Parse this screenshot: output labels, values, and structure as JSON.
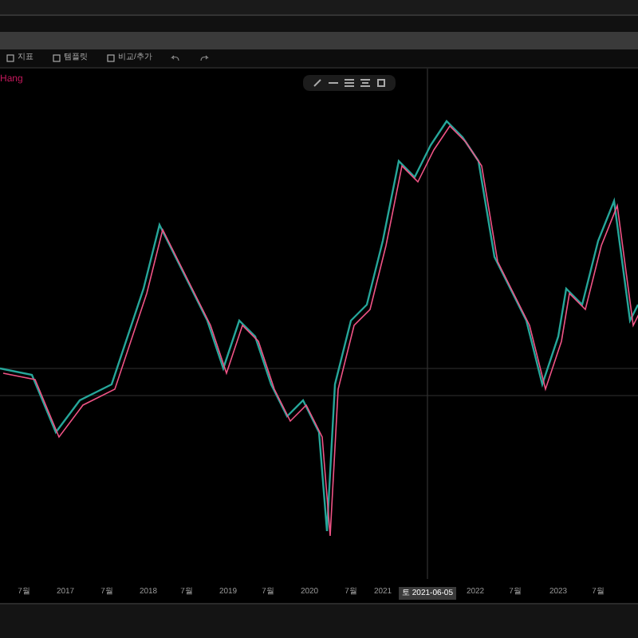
{
  "toolbar": {
    "buttons": [
      {
        "kind": "icon",
        "label": "지표"
      },
      {
        "kind": "icon",
        "label": "템플릿"
      },
      {
        "kind": "icon",
        "label": "비교/추가"
      }
    ]
  },
  "legend": {
    "text": "Hang"
  },
  "x_axis": {
    "labels": [
      "7월",
      "2017",
      "7월",
      "2018",
      "7월",
      "2019",
      "7월",
      "2020",
      "7월",
      "2021",
      "2022",
      "7월",
      "2023",
      "7월"
    ],
    "crosshair_label": "토 2021-06-05"
  }
}
